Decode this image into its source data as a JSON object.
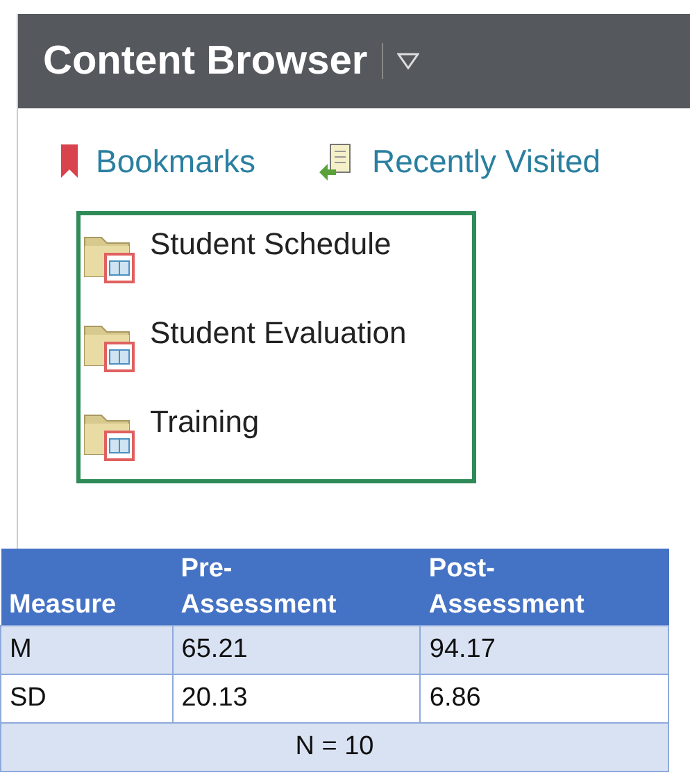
{
  "header": {
    "title": "Content Browser"
  },
  "links": [
    {
      "kind": "bookmark",
      "label": "Bookmarks"
    },
    {
      "kind": "recent",
      "label": "Recently Visited"
    }
  ],
  "folders": [
    {
      "name": "Student Schedule"
    },
    {
      "name": "Student Evaluation"
    },
    {
      "name": "Training"
    }
  ],
  "table": {
    "columns": [
      {
        "bottom": "Measure"
      },
      {
        "top": "Pre-",
        "bottom": "Assessment"
      },
      {
        "top": "Post-",
        "bottom": "Assessment"
      }
    ],
    "rows": [
      [
        "M",
        "65.21",
        "94.17"
      ],
      [
        "SD",
        "20.13",
        "6.86"
      ]
    ],
    "footer": "N = 10"
  }
}
